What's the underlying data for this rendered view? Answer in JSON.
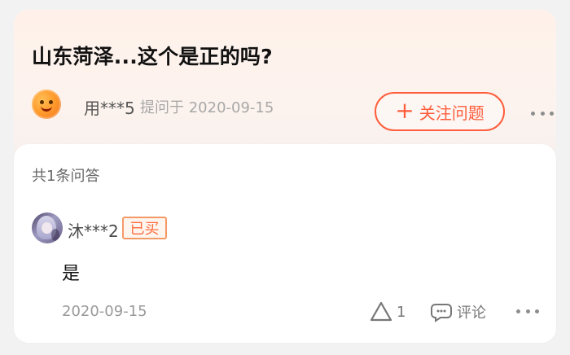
{
  "question": {
    "title": "山东菏泽...这个是正的吗?",
    "asker_name": "用***5",
    "asker_meta": "提问于 2020-09-15",
    "follow_label": "关注问题",
    "plus_symbol": "+"
  },
  "answers": {
    "count_label": "共1条问答",
    "items": [
      {
        "user_name": "沐***2",
        "badge_label": "已买",
        "text": "是",
        "date": "2020-09-15",
        "likes": "1",
        "comment_label": "评论"
      }
    ]
  },
  "icons": {
    "asker_avatar": "orange-face-avatar",
    "follow": "plus-icon",
    "more": "more-icon",
    "like": "triangle-icon",
    "comment": "comment-icon"
  },
  "colors": {
    "accent": "#ff5d3b",
    "badge_border": "#f39a67",
    "question_card": "#fff1ea",
    "muted_text": "#9a9a9a"
  }
}
